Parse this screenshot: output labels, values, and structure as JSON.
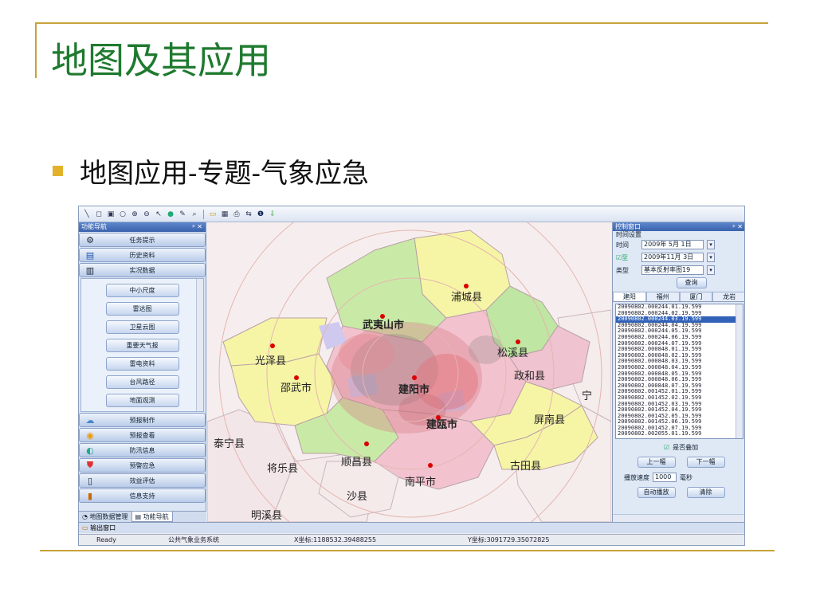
{
  "slide": {
    "title": "地图及其应用",
    "bullet": "地图应用-专题-气象应急"
  },
  "app": {
    "toolbar_icons": [
      "select-icon",
      "rect-icon",
      "circle-icon",
      "zoom-in-icon",
      "zoom-out-icon",
      "pointer-icon",
      "globe-icon",
      "draw-icon",
      "magnify-icon",
      "folder-icon",
      "save-icon",
      "print-icon",
      "refresh-icon",
      "info-icon",
      "download-icon"
    ],
    "left_panel": {
      "title": "功能导航",
      "pin": "ᵖ ✕",
      "top_items": [
        {
          "label": "任务提示",
          "icon": "task-icon"
        },
        {
          "label": "历史资料",
          "icon": "history-icon"
        },
        {
          "label": "实况数据",
          "icon": "live-data-icon"
        }
      ],
      "sub_items": [
        "中小尺度",
        "雷达图",
        "卫星云图",
        "重要天气报",
        "雷电资料",
        "台风路径",
        "地面观测"
      ],
      "bottom_items": [
        {
          "label": "预报制作",
          "icon": "forecast-icon"
        },
        {
          "label": "预报查看",
          "icon": "view-icon"
        },
        {
          "label": "防汛信息",
          "icon": "flood-icon"
        },
        {
          "label": "预警应急",
          "icon": "warning-icon"
        },
        {
          "label": "效益评估",
          "icon": "evaluate-icon"
        },
        {
          "label": "信息支持",
          "icon": "support-icon"
        }
      ],
      "tabs": [
        "地图数据管理",
        "功能导航"
      ]
    },
    "map": {
      "labels": [
        {
          "id": "pucheng",
          "text": "浦城县"
        },
        {
          "id": "wuyishan",
          "text": "武夷山市"
        },
        {
          "id": "guangze",
          "text": "光泽县"
        },
        {
          "id": "songxi",
          "text": "松溪县"
        },
        {
          "id": "zhenghe",
          "text": "政和县"
        },
        {
          "id": "shaowu",
          "text": "邵武市"
        },
        {
          "id": "jianyang",
          "text": "建阳市"
        },
        {
          "id": "ning",
          "text": "宁"
        },
        {
          "id": "jianou",
          "text": "建瓯市"
        },
        {
          "id": "pingnan",
          "text": "屏南县"
        },
        {
          "id": "taining",
          "text": "泰宁县"
        },
        {
          "id": "shunchang",
          "text": "顺昌县"
        },
        {
          "id": "jiangle",
          "text": "将乐县"
        },
        {
          "id": "gutian",
          "text": "古田县"
        },
        {
          "id": "nanping",
          "text": "南平市"
        },
        {
          "id": "shaxian",
          "text": "沙县"
        },
        {
          "id": "mingxi",
          "text": "明溪县"
        }
      ]
    },
    "right_panel": {
      "title": "控制窗口",
      "pin": "ᵖ ✕",
      "section": "时间设置",
      "time_label": "时间",
      "time_value": "2009年 5月 1日",
      "to_label": "至",
      "to_value": "2009年11月 3日",
      "type_label": "类型",
      "type_value": "基本反射率图19",
      "query_button": "查询",
      "tabs": [
        "建阳",
        "福州",
        "厦门",
        "龙岩"
      ],
      "list": [
        "20090802.000244.01.19.599",
        "20090802.000244.02.19.599",
        "20090802.000244.03.19.599",
        "20090802.000244.04.19.599",
        "20090802.000244.05.19.599",
        "20090802.000244.06.19.599",
        "20090802.000244.07.19.599",
        "20090802.000848.01.19.599",
        "20090802.000848.02.19.599",
        "20090802.000848.03.19.599",
        "20090802.000848.04.19.599",
        "20090802.000848.05.19.599",
        "20090802.000848.06.19.599",
        "20090802.000848.07.19.599",
        "20090802.001452.01.19.599",
        "20090802.001452.02.19.599",
        "20090802.001452.03.19.599",
        "20090802.001452.04.19.599",
        "20090802.001452.05.19.599",
        "20090802.001452.06.19.599",
        "20090802.001452.07.19.599",
        "20090802.002055.01.19.599"
      ],
      "selected_index": 2,
      "overlay_label": "是否叠加",
      "prev_button": "上一幅",
      "next_button": "下一幅",
      "speed_label": "播放速度",
      "speed_value": "1000",
      "speed_unit": "毫秒",
      "autoplay_button": "自动播放",
      "clear_button": "清除"
    },
    "output_tab": "输出窗口",
    "status": {
      "ready": "Ready",
      "system": "公共气象业务系统",
      "x": "X坐标:1188532.39488255",
      "y": "Y坐标:3091729.35072825"
    }
  }
}
